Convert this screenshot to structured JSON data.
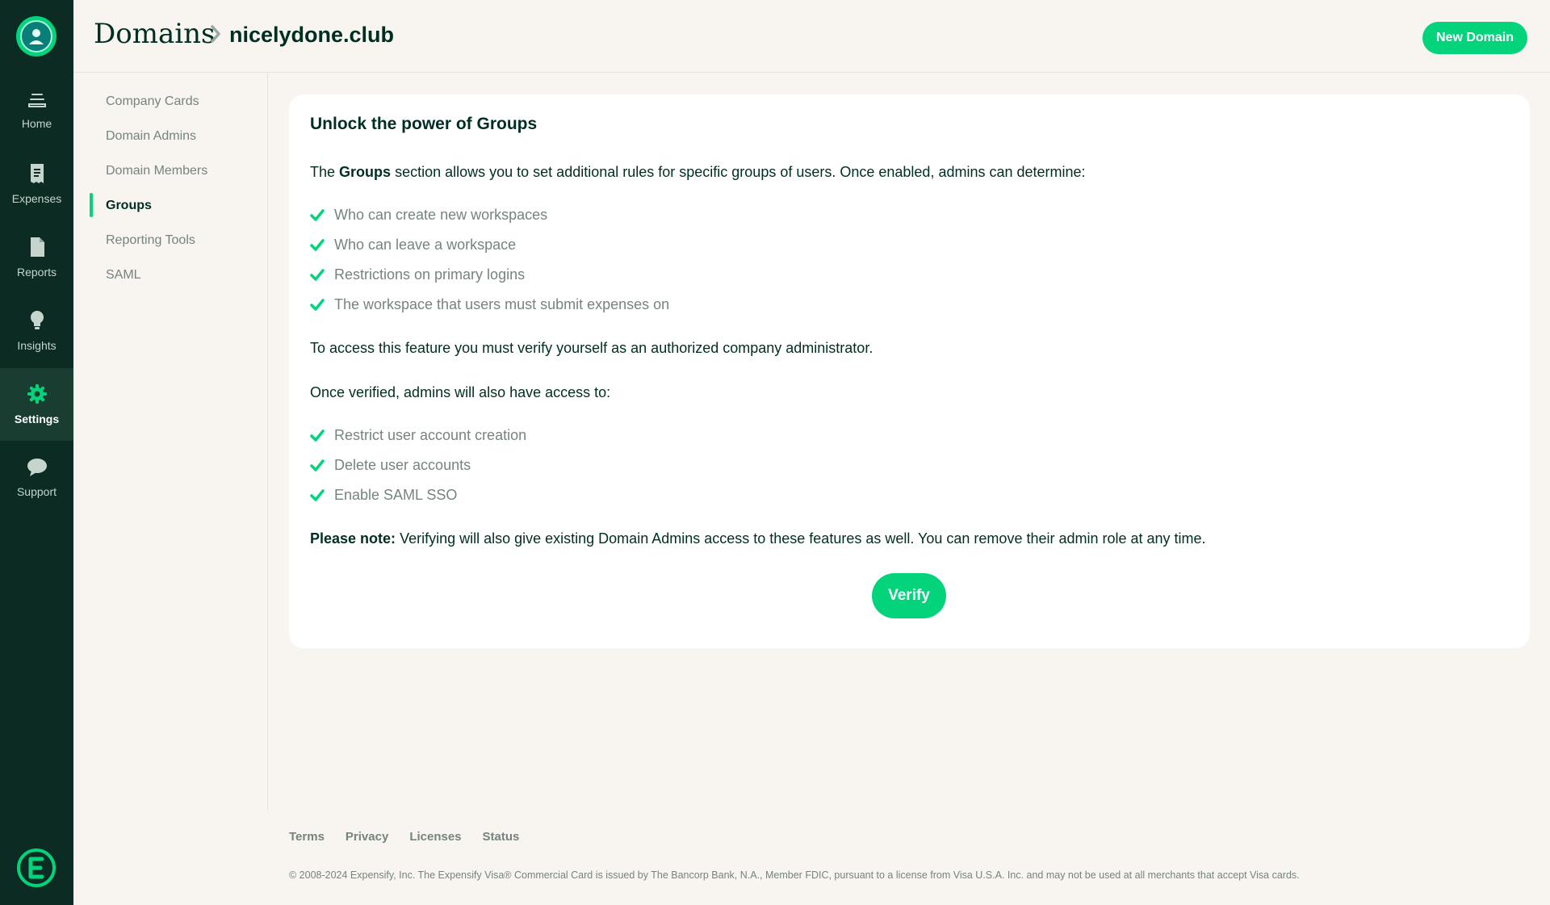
{
  "nav": {
    "items": [
      {
        "label": "Home",
        "icon": "home-icon"
      },
      {
        "label": "Expenses",
        "icon": "receipt-icon"
      },
      {
        "label": "Reports",
        "icon": "document-icon"
      },
      {
        "label": "Insights",
        "icon": "lightbulb-icon"
      },
      {
        "label": "Settings",
        "icon": "gear-icon",
        "active": true
      },
      {
        "label": "Support",
        "icon": "chat-bubble-icon"
      }
    ]
  },
  "header": {
    "breadcrumb_root": "Domains",
    "breadcrumb_leaf": "nicelydone.club",
    "new_domain_label": "New Domain"
  },
  "submenu": {
    "items": [
      "Company Cards",
      "Domain Admins",
      "Domain Members",
      "Groups",
      "Reporting Tools",
      "SAML"
    ],
    "active": "Groups"
  },
  "card": {
    "title": "Unlock the power of Groups",
    "intro_prefix": "The",
    "intro_bold": "Groups",
    "intro_suffix": "section allows you to set additional rules for specific groups of users. Once enabled, admins can determine:",
    "rules": [
      "Who can create new workspaces",
      "Who can leave a workspace",
      "Restrictions on primary logins",
      "The workspace that users must submit expenses on"
    ],
    "access_text": "To access this feature you must verify yourself as an authorized company administrator.",
    "verified_text": "Once verified, admins will also have access to:",
    "verified_features": [
      "Restrict user account creation",
      "Delete user accounts",
      "Enable SAML SSO"
    ],
    "note_bold": "Please note:",
    "note_text": "Verifying will also give existing Domain Admins access to these features as well. You can remove their admin role at any time.",
    "verify_label": "Verify"
  },
  "footer": {
    "links": [
      "Terms",
      "Privacy",
      "Licenses",
      "Status"
    ],
    "legal": "© 2008-2024 Expensify, Inc. The Expensify Visa® Commercial Card is issued by The Bancorp Bank, N.A., Member FDIC, pursuant to a license from Visa U.S.A. Inc. and may not be used at all merchants that accept Visa cards."
  },
  "colors": {
    "accent": "#03d47c",
    "rail": "#0b2b23",
    "text": "#002e22",
    "muted": "#76847e",
    "background": "#f8f4f0"
  }
}
